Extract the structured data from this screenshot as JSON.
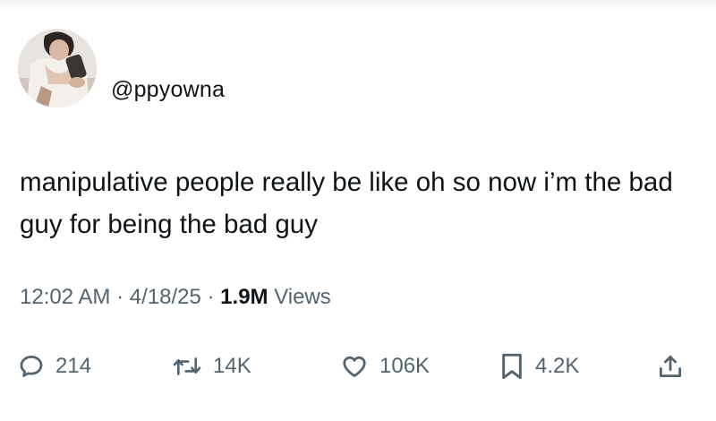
{
  "tweet": {
    "handle": "@ppyowna",
    "avatar_icon": "profile-photo-avatar",
    "text": "manipulative people really be like oh so now i’m the bad guy for being the bad guy",
    "time": "12:02 AM",
    "separator": "·",
    "date": "4/18/25",
    "views_count": "1.9M",
    "views_label": "Views"
  },
  "actions": {
    "replies": "214",
    "reposts": "14K",
    "likes": "106K",
    "bookmarks": "4.2K"
  },
  "icons": {
    "reply": "speech-bubble-icon",
    "repost": "repost-arrows-icon",
    "like": "heart-icon",
    "bookmark": "bookmark-icon",
    "share": "share-upload-icon"
  },
  "colors": {
    "text": "#0f1419",
    "secondary": "#536471",
    "background": "#ffffff"
  }
}
